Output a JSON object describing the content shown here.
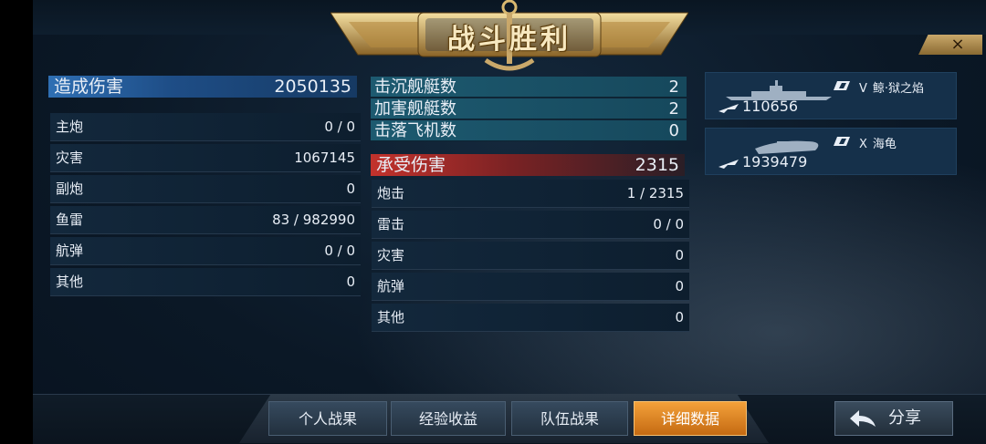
{
  "title": "战斗胜利",
  "close_icon": "×",
  "damage_dealt": {
    "label": "造成伤害",
    "total": "2050135",
    "rows": [
      {
        "label": "主炮",
        "value": "0 / 0"
      },
      {
        "label": "灾害",
        "value": "1067145"
      },
      {
        "label": "副炮",
        "value": "0"
      },
      {
        "label": "鱼雷",
        "value": "83 / 982990"
      },
      {
        "label": "航弹",
        "value": "0 / 0"
      },
      {
        "label": "其他",
        "value": "0"
      }
    ]
  },
  "kills": [
    {
      "label": "击沉舰艇数",
      "value": "2"
    },
    {
      "label": "加害舰艇数",
      "value": "2"
    },
    {
      "label": "击落飞机数",
      "value": "0"
    }
  ],
  "damage_taken": {
    "label": "承受伤害",
    "total": "2315",
    "rows": [
      {
        "label": "炮击",
        "value": "1 / 2315"
      },
      {
        "label": "雷击",
        "value": "0 / 0"
      },
      {
        "label": "灾害",
        "value": "0"
      },
      {
        "label": "航弹",
        "value": "0"
      },
      {
        "label": "其他",
        "value": "0"
      }
    ]
  },
  "enemies": [
    {
      "tier": "V",
      "name": "鲸·狱之焰",
      "damage": "110656"
    },
    {
      "tier": "X",
      "name": "海龟",
      "damage": "1939479"
    }
  ],
  "tabs": [
    {
      "label": "个人战果",
      "active": false
    },
    {
      "label": "经验收益",
      "active": false
    },
    {
      "label": "队伍战果",
      "active": false
    },
    {
      "label": "详细数据",
      "active": true
    }
  ],
  "share_label": "分享",
  "colors": {
    "gold": "#c9a86a",
    "active_tab": "#f3a13a",
    "blue_header": "#2f6fb3",
    "red_header": "#c2322c"
  }
}
